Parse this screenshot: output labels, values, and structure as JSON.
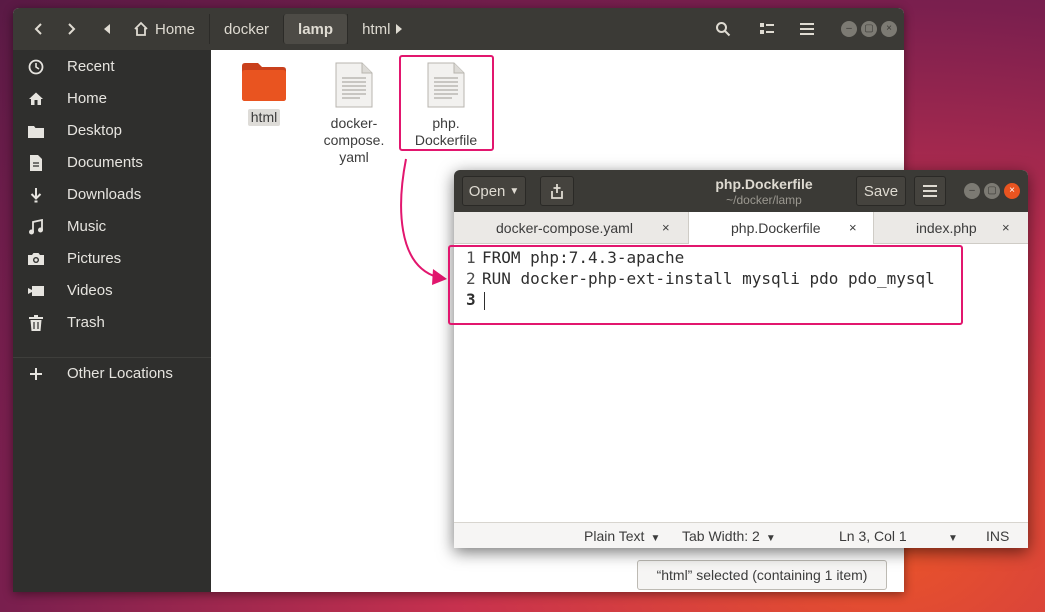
{
  "file_manager": {
    "breadcrumbs": [
      {
        "label": "Home",
        "icon": "home-icon"
      },
      {
        "label": "docker"
      },
      {
        "label": "lamp",
        "active": true
      },
      {
        "label": "html"
      }
    ],
    "sidebar": {
      "items": [
        {
          "label": "Recent",
          "icon": "clock-icon"
        },
        {
          "label": "Home",
          "icon": "home-icon"
        },
        {
          "label": "Desktop",
          "icon": "folder-icon"
        },
        {
          "label": "Documents",
          "icon": "document-icon"
        },
        {
          "label": "Downloads",
          "icon": "download-icon"
        },
        {
          "label": "Music",
          "icon": "music-icon"
        },
        {
          "label": "Pictures",
          "icon": "camera-icon"
        },
        {
          "label": "Videos",
          "icon": "video-icon"
        },
        {
          "label": "Trash",
          "icon": "trash-icon"
        }
      ],
      "other_locations": "Other Locations"
    },
    "files": [
      {
        "name": "html",
        "type": "folder",
        "selected": true
      },
      {
        "name": "docker-\ncompose.\nyaml",
        "type": "text"
      },
      {
        "name": "php.\nDockerfile",
        "type": "text",
        "highlighted": true
      }
    ],
    "status": "“html” selected  (containing 1 item)"
  },
  "editor": {
    "open_label": "Open",
    "title": "php.Dockerfile",
    "subtitle": "~/docker/lamp",
    "save_label": "Save",
    "tabs": [
      {
        "label": "docker-compose.yaml",
        "close": "×"
      },
      {
        "label": "php.Dockerfile",
        "close": "×",
        "active": true
      },
      {
        "label": "index.php",
        "close": "×"
      }
    ],
    "lines": [
      {
        "num": "1",
        "text": "FROM php:7.4.3-apache"
      },
      {
        "num": "2",
        "text": "RUN docker-php-ext-install mysqli pdo pdo_mysql"
      },
      {
        "num": "3",
        "text": ""
      }
    ],
    "statusbar": {
      "language": "Plain Text",
      "tab_width": "Tab Width: 2",
      "position": "Ln 3, Col 1",
      "mode": "INS"
    }
  },
  "colors": {
    "highlight": "#e2166e",
    "folder": "#e95420",
    "header": "#3b3a36",
    "sidebar": "#2f2f2d"
  }
}
